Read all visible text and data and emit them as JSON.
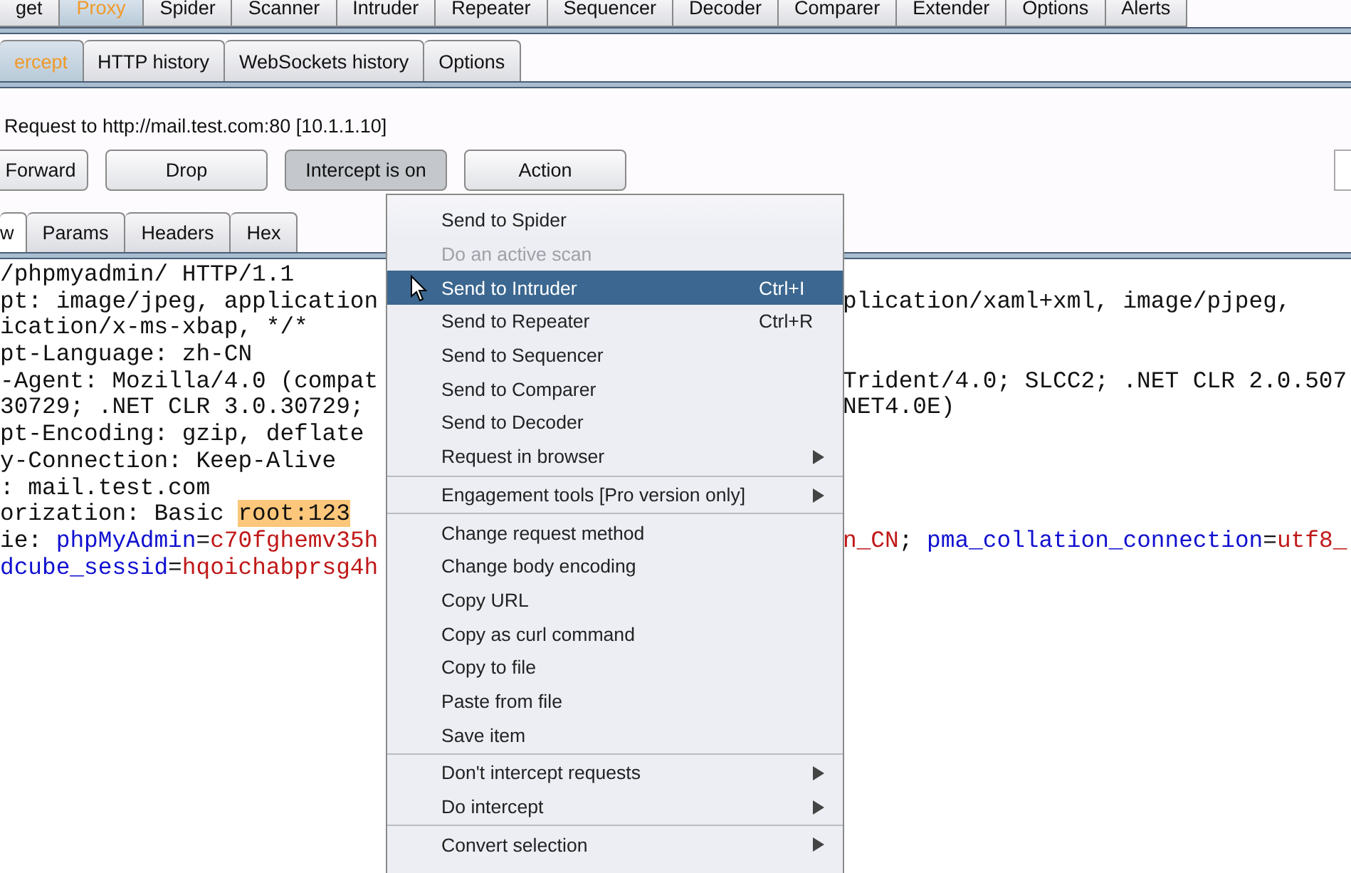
{
  "main_tabs": [
    {
      "label": "get",
      "selected": false
    },
    {
      "label": "Proxy",
      "selected": true
    },
    {
      "label": "Spider",
      "selected": false
    },
    {
      "label": "Scanner",
      "selected": false
    },
    {
      "label": "Intruder",
      "selected": false
    },
    {
      "label": "Repeater",
      "selected": false
    },
    {
      "label": "Sequencer",
      "selected": false
    },
    {
      "label": "Decoder",
      "selected": false
    },
    {
      "label": "Comparer",
      "selected": false
    },
    {
      "label": "Extender",
      "selected": false
    },
    {
      "label": "Options",
      "selected": false
    },
    {
      "label": "Alerts",
      "selected": false
    }
  ],
  "proxy_tabs": [
    {
      "label": "ercept",
      "selected": true
    },
    {
      "label": "HTTP history",
      "selected": false
    },
    {
      "label": "WebSockets history",
      "selected": false
    },
    {
      "label": "Options",
      "selected": false
    }
  ],
  "request_info": "Request to http://mail.test.com:80  [10.1.1.10]",
  "buttons": [
    {
      "label": "Forward",
      "pressed": false
    },
    {
      "label": "Drop",
      "pressed": false
    },
    {
      "label": "Intercept is on",
      "pressed": true
    },
    {
      "label": "Action",
      "pressed": false
    }
  ],
  "editor_tabs": [
    {
      "label": "w",
      "selected": true
    },
    {
      "label": "Params",
      "selected": false
    },
    {
      "label": "Headers",
      "selected": false
    },
    {
      "label": "Hex",
      "selected": false
    }
  ],
  "request_lines": [
    {
      "left": [
        {
          "text": "/phpmyadmin/ HTTP/1.1",
          "kind": "plain"
        }
      ]
    },
    {
      "left": [
        {
          "text": "pt: image/jpeg, application",
          "kind": "plain"
        }
      ],
      "right": [
        {
          "text": "plication/xaml+xml, image/pjpeg,",
          "kind": "plain"
        }
      ]
    },
    {
      "left": [
        {
          "text": "ication/x-ms-xbap, */*",
          "kind": "plain"
        }
      ]
    },
    {
      "left": [
        {
          "text": "pt-Language: zh-CN",
          "kind": "plain"
        }
      ]
    },
    {
      "left": [
        {
          "text": "-Agent: Mozilla/4.0 (compat",
          "kind": "plain"
        }
      ],
      "right": [
        {
          "text": "Trident/4.0; SLCC2; .NET CLR 2.0.507",
          "kind": "plain"
        }
      ]
    },
    {
      "left": [
        {
          "text": "30729; .NET CLR 3.0.30729;",
          "kind": "plain"
        }
      ],
      "right": [
        {
          "text": "NET4.0E)",
          "kind": "plain"
        }
      ]
    },
    {
      "left": [
        {
          "text": "pt-Encoding: gzip, deflate",
          "kind": "plain"
        }
      ]
    },
    {
      "left": [
        {
          "text": "y-Connection: Keep-Alive",
          "kind": "plain"
        }
      ]
    },
    {
      "left": [
        {
          "text": ": mail.test.com",
          "kind": "plain"
        }
      ]
    },
    {
      "left": [
        {
          "text": "orization: Basic ",
          "kind": "plain"
        },
        {
          "text": "root:123",
          "kind": "highlight"
        }
      ]
    },
    {
      "left": [
        {
          "text": "ie: ",
          "kind": "plain"
        },
        {
          "text": "phpMyAdmin",
          "kind": "name"
        },
        {
          "text": "=",
          "kind": "plain"
        },
        {
          "text": "c70fghemv35h",
          "kind": "value"
        }
      ],
      "right": [
        {
          "text": "n_CN",
          "kind": "value"
        },
        {
          "text": "; ",
          "kind": "plain"
        },
        {
          "text": "pma_collation_connection",
          "kind": "name"
        },
        {
          "text": "=",
          "kind": "plain"
        },
        {
          "text": "utf8_",
          "kind": "value"
        }
      ]
    },
    {
      "left": [
        {
          "text": "dcube_sessid",
          "kind": "name"
        },
        {
          "text": "=",
          "kind": "plain"
        },
        {
          "text": "hqoichabprsg4h",
          "kind": "value"
        }
      ]
    }
  ],
  "context_menu": [
    {
      "kind": "item",
      "label": "Send to Spider",
      "disabled": false,
      "selected": false,
      "submenu": false
    },
    {
      "kind": "item",
      "label": "Do an active scan",
      "disabled": true,
      "selected": false,
      "submenu": false
    },
    {
      "kind": "item",
      "label": "Send to Intruder",
      "shortcut": "Ctrl+I",
      "disabled": false,
      "selected": true,
      "submenu": false
    },
    {
      "kind": "item",
      "label": "Send to Repeater",
      "shortcut": "Ctrl+R",
      "disabled": false,
      "selected": false,
      "submenu": false
    },
    {
      "kind": "item",
      "label": "Send to Sequencer",
      "disabled": false,
      "selected": false,
      "submenu": false
    },
    {
      "kind": "item",
      "label": "Send to Comparer",
      "disabled": false,
      "selected": false,
      "submenu": false
    },
    {
      "kind": "item",
      "label": "Send to Decoder",
      "disabled": false,
      "selected": false,
      "submenu": false
    },
    {
      "kind": "item",
      "label": "Request in browser",
      "disabled": false,
      "selected": false,
      "submenu": true
    },
    {
      "kind": "separator"
    },
    {
      "kind": "item",
      "label": "Engagement tools [Pro version only]",
      "disabled": false,
      "selected": false,
      "submenu": true
    },
    {
      "kind": "separator"
    },
    {
      "kind": "item",
      "label": "Change request method",
      "disabled": false,
      "selected": false,
      "submenu": false
    },
    {
      "kind": "item",
      "label": "Change body encoding",
      "disabled": false,
      "selected": false,
      "submenu": false
    },
    {
      "kind": "item",
      "label": "Copy URL",
      "disabled": false,
      "selected": false,
      "submenu": false
    },
    {
      "kind": "item",
      "label": "Copy as curl command",
      "disabled": false,
      "selected": false,
      "submenu": false
    },
    {
      "kind": "item",
      "label": "Copy to file",
      "disabled": false,
      "selected": false,
      "submenu": false
    },
    {
      "kind": "item",
      "label": "Paste from file",
      "disabled": false,
      "selected": false,
      "submenu": false
    },
    {
      "kind": "item",
      "label": "Save item",
      "disabled": false,
      "selected": false,
      "submenu": false
    },
    {
      "kind": "separator"
    },
    {
      "kind": "item",
      "label": "Don't intercept requests",
      "disabled": false,
      "selected": false,
      "submenu": true
    },
    {
      "kind": "item",
      "label": "Do intercept",
      "disabled": false,
      "selected": false,
      "submenu": true
    },
    {
      "kind": "separator"
    },
    {
      "kind": "item",
      "label": "Convert selection",
      "disabled": false,
      "selected": false,
      "submenu": true
    }
  ]
}
